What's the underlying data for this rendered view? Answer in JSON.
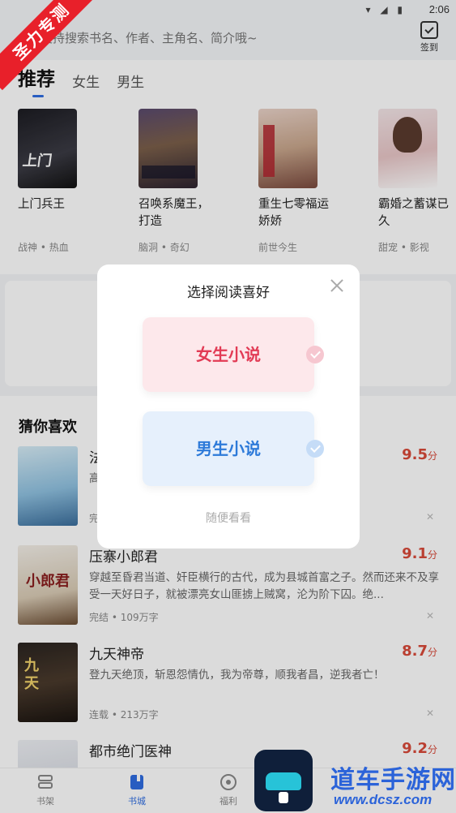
{
  "status": {
    "time": "2:06"
  },
  "header": {
    "search_placeholder": "支持搜索书名、作者、主角名、简介哦~",
    "checkin_label": "签到"
  },
  "tabs": [
    "推荐",
    "女生",
    "男生"
  ],
  "recommend": [
    {
      "title": "上门兵王",
      "tags": "战神 • 热血"
    },
    {
      "title": "召唤系魔王，打造",
      "tags": "脑洞 • 奇幻"
    },
    {
      "title": "重生七零福运娇娇",
      "tags": "前世今生"
    },
    {
      "title": "霸婚之蓄谋已久",
      "tags": "甜宠 • 影视"
    }
  ],
  "guess": {
    "title": "猜你喜欢",
    "items": [
      {
        "title": "法医",
        "score": "9.5",
        "unit": "分",
        "desc": "高... 视，自己好像 被... 案情，他来旁...",
        "meta": "完结"
      },
      {
        "title": "压寨小郎君",
        "score": "9.1",
        "unit": "分",
        "desc": "穿越至昏君当道、奸臣横行的古代，成为县城首富之子。然而还来不及享受一天好日子，就被漂亮女山匪掳上贼窝，沦为阶下囚。绝...",
        "meta": "完结 • 109万字"
      },
      {
        "title": "九天神帝",
        "score": "8.7",
        "unit": "分",
        "desc": "登九天绝顶，斩恩怨情仇，我为帝尊，顺我者昌，逆我者亡！",
        "meta": "连载 • 213万字"
      },
      {
        "title": "都市绝门医神",
        "score": "9.2",
        "unit": "分",
        "desc": "",
        "meta": ""
      }
    ]
  },
  "nav": [
    {
      "label": "书架"
    },
    {
      "label": "书城"
    },
    {
      "label": "福利"
    }
  ],
  "dialog": {
    "title": "选择阅读喜好",
    "female_label": "女生小说",
    "male_label": "男生小说",
    "skip_label": "随便看看"
  },
  "badge": {
    "text": "圣力专测"
  },
  "watermark": {
    "text": "道车手游网",
    "url": "www.dcsz.com"
  },
  "colors": {
    "accent": "#2f6de1",
    "score": "#d94a3a",
    "female": "#e23b55",
    "male": "#2d7ad9",
    "badge": "#e8202a"
  }
}
